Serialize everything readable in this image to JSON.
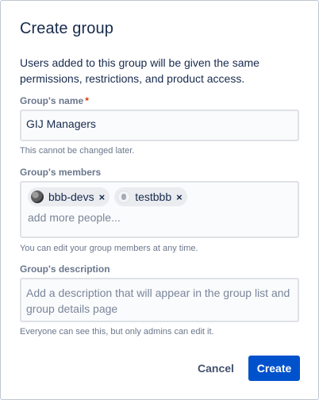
{
  "dialog": {
    "title": "Create group",
    "intro": "Users added to this group will be given the same permissions, restrictions, and product access."
  },
  "name_field": {
    "label": "Group's name",
    "required_marker": "*",
    "value": "GIJ Managers",
    "help": "This cannot be changed later."
  },
  "members_field": {
    "label": "Group's members",
    "members": [
      {
        "name": "bbb-devs",
        "remove": "×",
        "avatar": "group-avatar-icon"
      },
      {
        "name": "testbbb",
        "remove": "×",
        "avatar": "user-avatar-icon"
      }
    ],
    "placeholder": "add more people...",
    "help": "You can edit your group members at any time."
  },
  "description_field": {
    "label": "Group's description",
    "placeholder": "Add a description that will appear in the group list and group details page",
    "help": "Everyone can see this, but only admins can edit it."
  },
  "buttons": {
    "cancel": "Cancel",
    "create": "Create"
  },
  "colors": {
    "primary": "#0052cc",
    "required": "#de350b",
    "muted_text": "#6b778c",
    "field_border": "#dfe1e6"
  }
}
